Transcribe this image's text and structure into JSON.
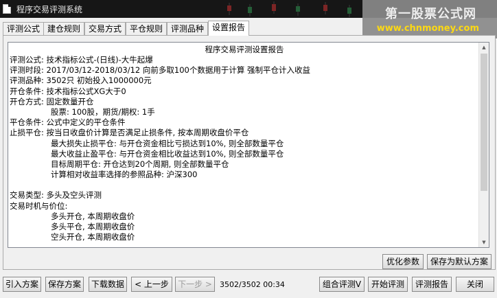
{
  "window": {
    "title": "程序交易评测系统"
  },
  "watermark": {
    "brand": "第一股票公式网",
    "url": "www.chnmoney.com"
  },
  "tabs": [
    {
      "label": "评测公式"
    },
    {
      "label": "建仓规则"
    },
    {
      "label": "交易方式"
    },
    {
      "label": "平仓规则"
    },
    {
      "label": "评测品种"
    },
    {
      "label": "设置报告"
    }
  ],
  "report": {
    "title": "程序交易评测设置报告",
    "lines": [
      "评测公式: 技术指标公式-(日线)-大牛起爆",
      "评测时段: 2017/03/12-2018/03/12 向前多取100个数据用于计算 强制平仓计入收益",
      "评测品种: 3502只 初始投入1000000元",
      "开仓条件: 技术指标公式XG大于0",
      "开仓方式: 固定数量开仓",
      "股票: 100股，期货/期权: 1手",
      "平仓条件: 公式中定义的平仓条件",
      "止损平仓: 按当日收盘价计算是否满足止损条件, 按本周期收盘价平仓",
      "最大损失止损平仓: 与开仓资金相比亏损达到10%, 则全部数量平仓",
      "最大收益止盈平仓: 与开仓资金相比收益达到10%, 则全部数量平仓",
      "目标周期平仓: 开仓达到20个周期, 则全部数量平仓",
      "计算相对收益率选择的参照品种: 沪深300",
      "",
      "交易类型: 多头及空头评测",
      "交易时机与价位:",
      "多头开仓, 本周期收盘价",
      "多头平仓, 本周期收盘价",
      "空头开仓, 本周期收盘价"
    ]
  },
  "buttons": {
    "optimize": "优化参数",
    "save_default": "保存为默认方案",
    "import": "引入方案",
    "save": "保存方案",
    "download": "下载数据",
    "prev": "< 上一步",
    "next": "下一步 >",
    "combo": "组合评测V",
    "start": "开始评测",
    "report": "评测报告",
    "close": "关闭"
  },
  "status": {
    "progress": "3502/3502 00:34"
  }
}
